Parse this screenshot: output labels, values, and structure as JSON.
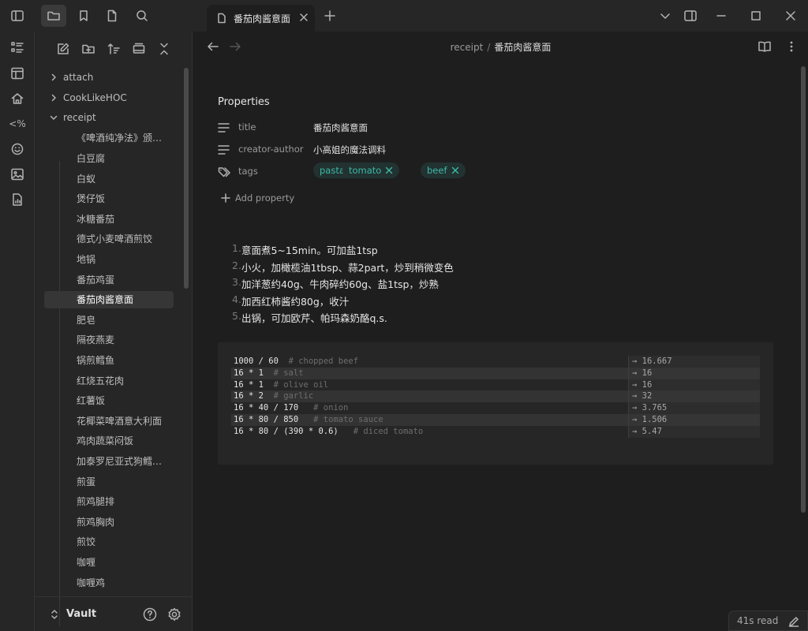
{
  "tab": {
    "title": "番茄肉酱意面"
  },
  "ribbon": {
    "code_label": "<%"
  },
  "sidebar": {
    "folders": [
      {
        "label": "attach",
        "expanded": false
      },
      {
        "label": "CookLikeHOC",
        "expanded": false
      },
      {
        "label": "receipt",
        "expanded": true
      }
    ],
    "files": [
      "《啤酒纯净法》颁…",
      "白豆腐",
      "白蚁",
      "煲仔饭",
      "冰糖番茄",
      "德式小麦啤酒煎饺",
      "地锅",
      "番茄鸡蛋",
      "番茄肉酱意面",
      "肥皂",
      "隔夜燕麦",
      "锅煎鳕鱼",
      "红烧五花肉",
      "红薯饭",
      "花椰菜啤酒意大利面",
      "鸡肉蔬菜闷饭",
      "加泰罗尼亚式狗鳕…",
      "煎蛋",
      "煎鸡腿排",
      "煎鸡胸肉",
      "煎饺",
      "咖喱",
      "咖喱鸡"
    ],
    "active_file": "番茄肉酱意面",
    "vault_name": "Vault"
  },
  "breadcrumb": {
    "folder": "receipt",
    "separator": "/",
    "note": "番茄肉酱意面"
  },
  "properties": {
    "heading": "Properties",
    "title_key": "title",
    "title_value": "番茄肉酱意面",
    "author_key": "creator-author",
    "author_value": "小高姐的魔法调料",
    "tags_key": "tags",
    "tags": [
      "pasta",
      "tomato",
      "beef"
    ],
    "add_label": "Add property"
  },
  "steps": [
    {
      "num": "1.",
      "text": "意面煮5~15min。可加盐1tsp"
    },
    {
      "num": "2.",
      "text": "小火，加橄榄油1tbsp、蒜2part，炒到稍微变色"
    },
    {
      "num": "3.",
      "text": "加洋葱约40g、牛肉碎约60g、盐1tsp，炒熟"
    },
    {
      "num": "4.",
      "text": "加西红柿酱约80g，收汁"
    },
    {
      "num": "5.",
      "text": "出锅，可加欧芹、帕玛森奶酪q.s."
    }
  ],
  "calc": [
    {
      "expr": "1000 / 60",
      "comment": "# chopped beef",
      "result": "→ 16.667"
    },
    {
      "expr": "16 * 1",
      "comment": "# salt",
      "result": "→ 16"
    },
    {
      "expr": "16 * 1",
      "comment": "# olive oil",
      "result": "→ 16"
    },
    {
      "expr": "16 * 2",
      "comment": "# garlic",
      "result": "→ 32"
    },
    {
      "expr": "16 * 40 / 170",
      "comment": "# onion",
      "result": "→ 3.765"
    },
    {
      "expr": "16 * 80 / 850",
      "comment": "# tomato sauce",
      "result": "→ 1.506"
    },
    {
      "expr": "16 * 80 / (390 * 0.6)",
      "comment": "# diced tomato",
      "result": "→ 5.47"
    }
  ],
  "status": {
    "reading_time": "41s read"
  },
  "colors": {
    "accent_tag_text": "#3fb9a6",
    "accent_tag_bg": "#213231",
    "background": "#1e1e1e",
    "panel": "#262626"
  }
}
